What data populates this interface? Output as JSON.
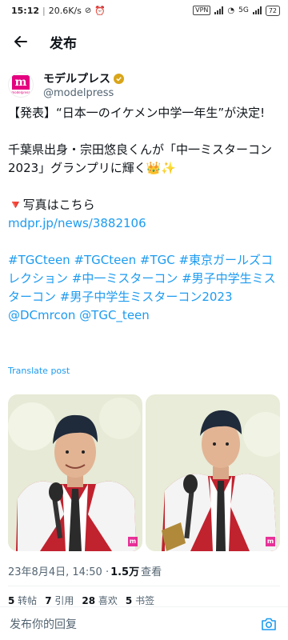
{
  "status_bar": {
    "time": "15:12",
    "speed": "20.6K/s",
    "vpn": "VPN",
    "network": "5G",
    "battery": "72"
  },
  "header": {
    "title": "发布"
  },
  "author": {
    "name": "モデルプレス",
    "handle": "@modelpress",
    "avatar_text": "m",
    "avatar_sub": "modelpress"
  },
  "tweet": {
    "line1": "【発表】“日本一のイケメン中学一年生”が決定!",
    "line2": "千葉県出身・宗田悠良くんが「中一ミスターコン2023」グランプリに輝く👑✨",
    "photo_label": "🔻写真はこちら",
    "link": "mdpr.jp/news/3882106",
    "hashtags": "#TGCteen #TGCteen #TGC #東京ガールズコレクション #中一ミスターコン #男子中学生ミスターコン #男子中学生ミスターコン2023 @DCmrcon @TGC_teen",
    "translate": "Translate post"
  },
  "meta": {
    "datetime": "23年8月4日, 14:50 · ",
    "views": "1.5万",
    "views_label": " 查看"
  },
  "stats": {
    "reposts": "5",
    "reposts_label": " 转帖",
    "quotes": "7",
    "quotes_label": " 引用",
    "likes": "28",
    "likes_label": " 喜欢",
    "bookmarks": "5",
    "bookmarks_label": " 书签"
  },
  "reply": {
    "placeholder": "发布你的回复"
  },
  "colors": {
    "link": "#1d9bf0",
    "brand": "#e4007f",
    "verified": "#d9a519"
  }
}
